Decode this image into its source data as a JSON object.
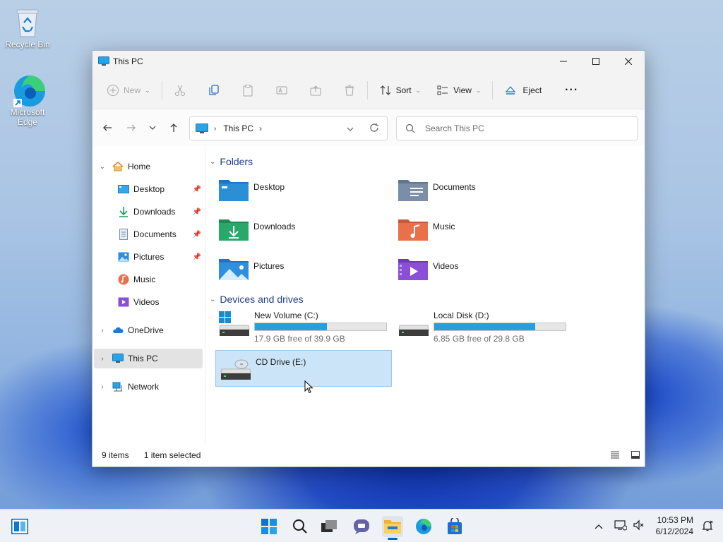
{
  "desktop": {
    "icons": [
      {
        "label": "Recycle Bin",
        "icon": "recycle-bin-icon"
      },
      {
        "label": "Microsoft Edge",
        "icon": "edge-icon"
      }
    ]
  },
  "window": {
    "title": "This PC",
    "toolbar": {
      "new_label": "New",
      "sort_label": "Sort",
      "view_label": "View",
      "eject_label": "Eject",
      "more_label": "···"
    },
    "address": {
      "location": "This PC",
      "search_placeholder": "Search This PC"
    },
    "sidebar": {
      "home": "Home",
      "pinned": [
        {
          "label": "Desktop",
          "icon": "desktop-icon"
        },
        {
          "label": "Downloads",
          "icon": "downloads-icon"
        },
        {
          "label": "Documents",
          "icon": "documents-icon"
        },
        {
          "label": "Pictures",
          "icon": "pictures-icon"
        },
        {
          "label": "Music",
          "icon": "music-icon"
        },
        {
          "label": "Videos",
          "icon": "videos-icon"
        }
      ],
      "onedrive": "OneDrive",
      "this_pc": "This PC",
      "network": "Network"
    },
    "content": {
      "folders_header": "Folders",
      "folders": [
        {
          "label": "Desktop",
          "color": "#2b8fd6"
        },
        {
          "label": "Documents",
          "color": "#7a8ea8"
        },
        {
          "label": "Downloads",
          "color": "#2aa86a"
        },
        {
          "label": "Music",
          "color": "#e8704a"
        },
        {
          "label": "Pictures",
          "color": "#2f8fdc"
        },
        {
          "label": "Videos",
          "color": "#8a4fd6"
        }
      ],
      "devices_header": "Devices and drives",
      "drives": [
        {
          "name": "New Volume (C:)",
          "free": "17.9 GB free of 39.9 GB",
          "used_fraction": 0.55
        },
        {
          "name": "Local Disk (D:)",
          "free": "6.85 GB free of 29.8 GB",
          "used_fraction": 0.77
        },
        {
          "name": "CD Drive (E:)"
        }
      ]
    },
    "status": {
      "items": "9 items",
      "selected": "1 item selected"
    }
  },
  "taskbar": {
    "time": "10:53 PM",
    "date": "6/12/2024",
    "accent": "#0067c0"
  }
}
